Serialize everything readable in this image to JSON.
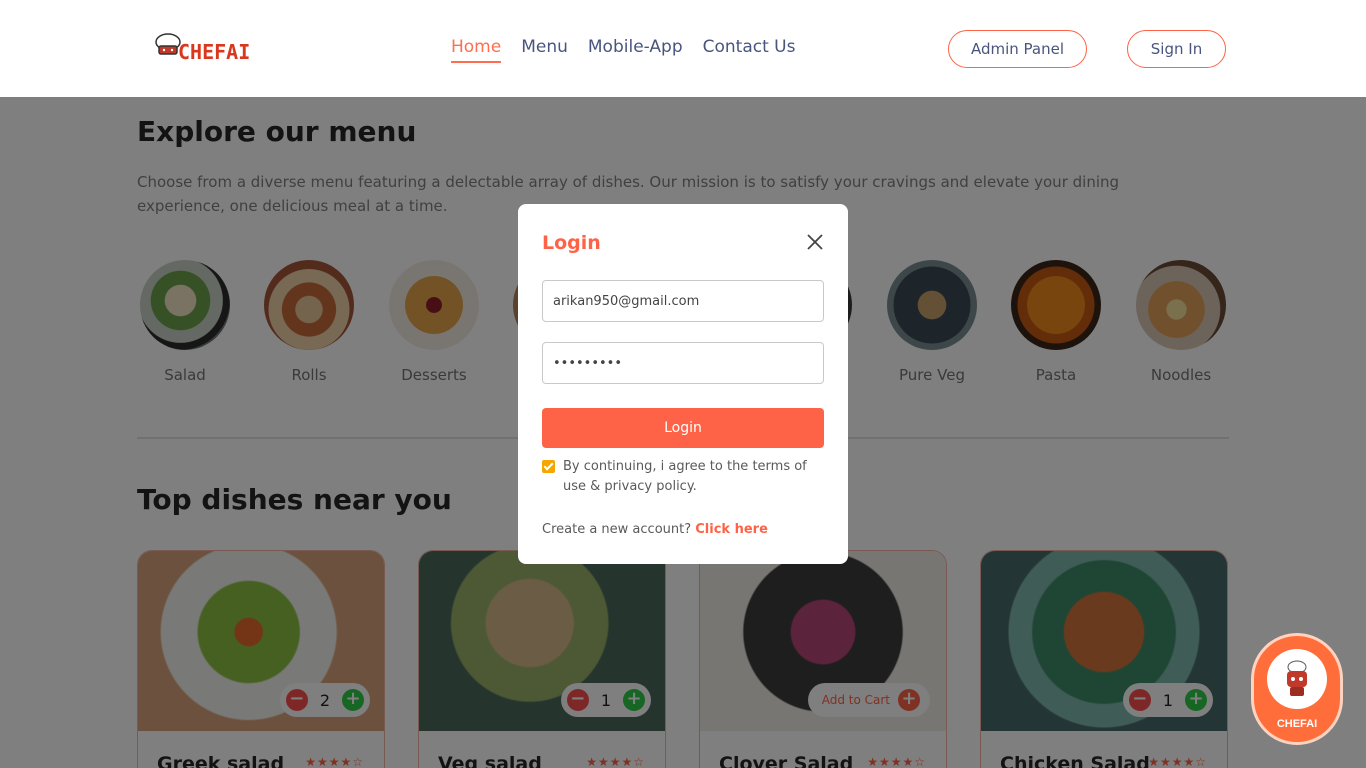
{
  "header": {
    "logo_text": "CHEFAI",
    "nav": [
      "Home",
      "Menu",
      "Mobile-App",
      "Contact Us"
    ],
    "active_nav": "Home",
    "admin_button": "Admin Panel",
    "signin_button": "Sign In"
  },
  "explore": {
    "title": "Explore our menu",
    "description": "Choose from a diverse menu featuring a delectable array of dishes. Our mission is to satisfy your cravings and elevate your dining experience, one delicious meal at a time.",
    "items": [
      {
        "label": "Salad"
      },
      {
        "label": "Rolls"
      },
      {
        "label": "Desserts"
      },
      {
        "label": ""
      },
      {
        "label": ""
      },
      {
        "label": ""
      },
      {
        "label": "Pure Veg"
      },
      {
        "label": "Pasta"
      },
      {
        "label": "Noodles"
      }
    ]
  },
  "top_dishes": {
    "title": "Top dishes near you",
    "cards": [
      {
        "name": "Greek salad",
        "count": "2",
        "rating": 4
      },
      {
        "name": "Veg salad",
        "count": "1",
        "rating": 4
      },
      {
        "name": "Clover Salad",
        "add_label": "Add to Cart",
        "rating": 4
      },
      {
        "name": "Chicken Salad",
        "count": "1",
        "rating": 4
      }
    ]
  },
  "login_modal": {
    "title": "Login",
    "email_value": "arikan950@gmail.com",
    "password_value": "•••••••••",
    "submit_label": "Login",
    "terms_text": "By continuing, i agree to the terms of use & privacy policy.",
    "terms_checked": true,
    "create_text": "Create a new account?",
    "create_link": "Click here"
  },
  "chat_widget": {
    "label": "CHEFAI"
  },
  "colors": {
    "accent": "#ff6347",
    "nav_text": "#49557e",
    "plus": "#2ecc48",
    "minus": "#fc4e4e"
  },
  "icons": {
    "close": "close-icon",
    "minus": "minus-icon",
    "plus": "plus-icon",
    "star": "star-icon"
  }
}
